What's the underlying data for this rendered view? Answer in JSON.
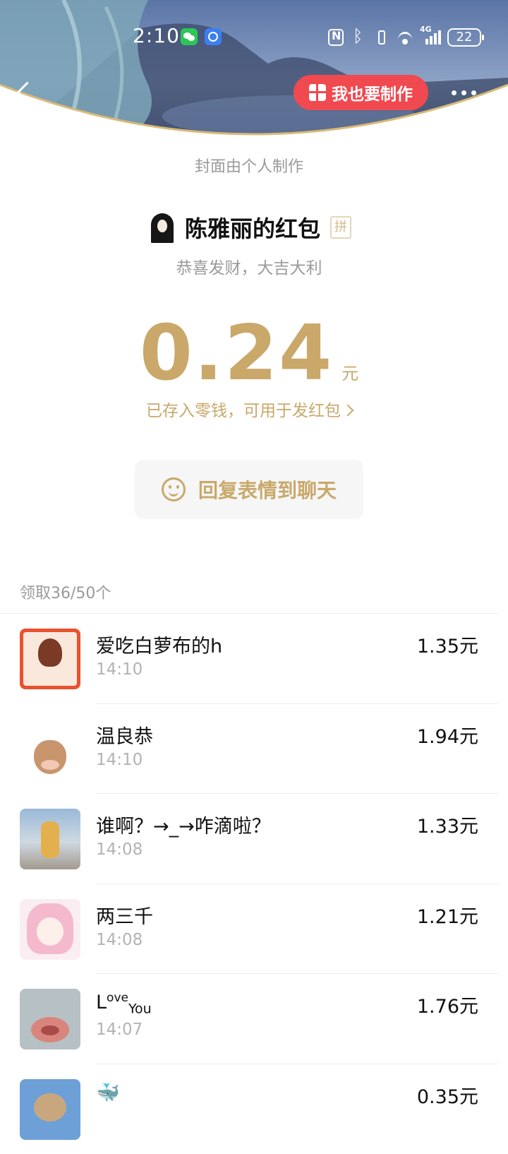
{
  "status_bar": {
    "time": "2:10",
    "network": "4G",
    "battery": "22",
    "icons": [
      "wechat-icon",
      "browser-icon",
      "nfc-icon",
      "bluetooth-icon",
      "vibrate-icon",
      "wifi-icon",
      "signal-icon",
      "battery-icon"
    ]
  },
  "header": {
    "make_button_label": "我也要制作",
    "cover_credit": "封面由个人制作"
  },
  "envelope": {
    "sender_name": "陈雅丽的红包",
    "pin_badge": "拼",
    "blessing": "恭喜发财，大吉大利",
    "amount": "0.24",
    "unit": "元",
    "saved_text": "已存入零钱，可用于发红包",
    "reply_label": "回复表情到聊天"
  },
  "records": {
    "summary": "领取36/50个",
    "items": [
      {
        "name": "爱吃白萝布的h",
        "time": "14:10",
        "amount": "1.35元"
      },
      {
        "name": "温良恭",
        "time": "14:10",
        "amount": "1.94元"
      },
      {
        "name": "谁啊？→_→咋滴啦？",
        "time": "14:08",
        "amount": "1.33元"
      },
      {
        "name": "两三千",
        "time": "14:08",
        "amount": "1.21元"
      },
      {
        "name_base": "L",
        "name_sup": "ove",
        "name_sub": "You",
        "time": "14:07",
        "amount": "1.76元"
      },
      {
        "name": "🐳",
        "time": "",
        "amount": "0.35元"
      }
    ]
  },
  "colors": {
    "gold": "#c9a86a",
    "red_button": "#f0494f",
    "muted_text": "#9a9a9a"
  }
}
